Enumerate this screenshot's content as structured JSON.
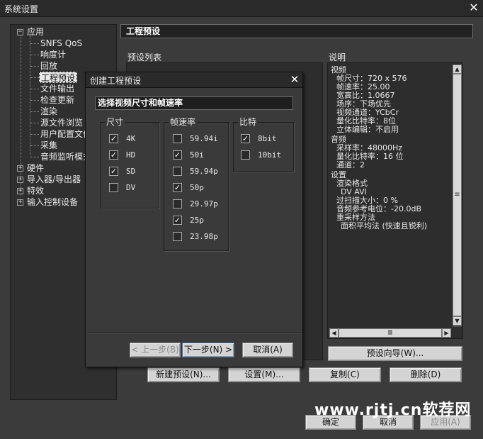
{
  "window": {
    "title": "系统设置"
  },
  "tree": {
    "app": "应用",
    "app_children": [
      "SNFS QoS",
      "响度计",
      "回放",
      "工程预设",
      "文件输出",
      "检查更新",
      "渲染",
      "源文件浏览",
      "用户配置文件",
      "采集",
      "音频监听模式"
    ],
    "others": [
      "硬件",
      "导入器/导出器",
      "特效",
      "输入控制设备"
    ]
  },
  "section": {
    "title": "工程预设"
  },
  "preset_list": {
    "label": "预设列表"
  },
  "description": {
    "label": "说明",
    "lines": [
      "视频",
      "帧尺寸：720 x 576",
      "帧速率：25.00",
      "宽高比：1.0667",
      "场序：下场优先",
      "视频通道：YCbCr",
      "量化比特率：8位",
      "立体编辑：不启用",
      "音频",
      "采样率：48000Hz",
      "量化比特率：16 位",
      "通道：2",
      "设置",
      "渲染格式",
      "DV AVI",
      "过扫描大小：0 %",
      "音频参考电位：-20.0dB",
      "重采样方法",
      "面积平均法 (快速且锐利)"
    ]
  },
  "buttons": {
    "preset_wizard": "预设向导(W)...",
    "new_preset": "新建预设(N)...",
    "settings": "设置(M)...",
    "copy": "复制(C)",
    "delete": "删除(D)",
    "ok": "确定",
    "cancel": "取消",
    "apply": "应用(A)"
  },
  "watermark": "www.rjtj.cn软荐网",
  "dialog": {
    "title": "创建工程预设",
    "subheader": "选择视频尺寸和帧速率",
    "size_group": {
      "title": "尺寸",
      "items": [
        {
          "label": "4K",
          "checked": true
        },
        {
          "label": "HD",
          "checked": true
        },
        {
          "label": "SD",
          "checked": true
        },
        {
          "label": "DV",
          "checked": false
        }
      ]
    },
    "fps_group": {
      "title": "帧速率",
      "items": [
        {
          "label": "59.94i",
          "checked": false
        },
        {
          "label": "50i",
          "checked": true
        },
        {
          "label": "59.94p",
          "checked": false
        },
        {
          "label": "50p",
          "checked": true
        },
        {
          "label": "29.97p",
          "checked": false
        },
        {
          "label": "25p",
          "checked": true
        },
        {
          "label": "23.98p",
          "checked": false
        }
      ]
    },
    "bit_group": {
      "title": "比特",
      "items": [
        {
          "label": "8bit",
          "checked": true
        },
        {
          "label": "10bit",
          "checked": false
        }
      ]
    },
    "buttons": {
      "prev": "< 上一步(B)",
      "next": "下一步(N) >",
      "cancel": "取消(A)"
    }
  }
}
